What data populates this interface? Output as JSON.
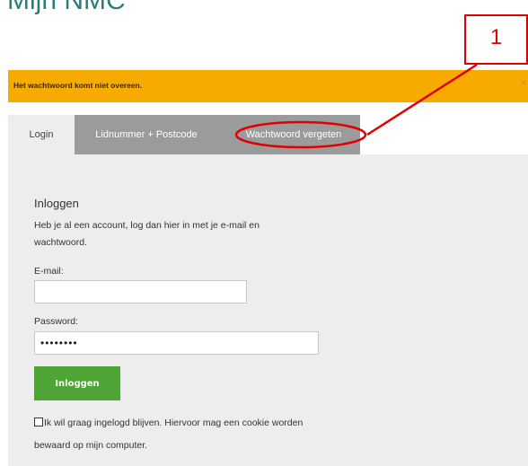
{
  "page": {
    "title": "Mijn NMC"
  },
  "alert": {
    "message": "Het wachtwoord komt niet overeen.",
    "close_symbol": "×",
    "color": "#f7ab00"
  },
  "tabs": [
    {
      "label": "Login"
    },
    {
      "label": "Lidnummer + Postcode"
    },
    {
      "label": "Wachtwoord vergeten"
    }
  ],
  "login": {
    "heading": "Inloggen",
    "description": "Heb je al een account, log dan hier in met je e-mail en wachtwoord.",
    "email_label": "E-mail:",
    "email_value": "",
    "password_label": "Password:",
    "password_value": "••••••••",
    "button_label": "Inloggen",
    "button_color": "#4ea535",
    "remember_text": "Ik wil graag ingelogd blijven. Hiervoor mag een cookie worden bewaard op mijn computer."
  },
  "annotation": {
    "number": "1",
    "color": "#e00000"
  }
}
